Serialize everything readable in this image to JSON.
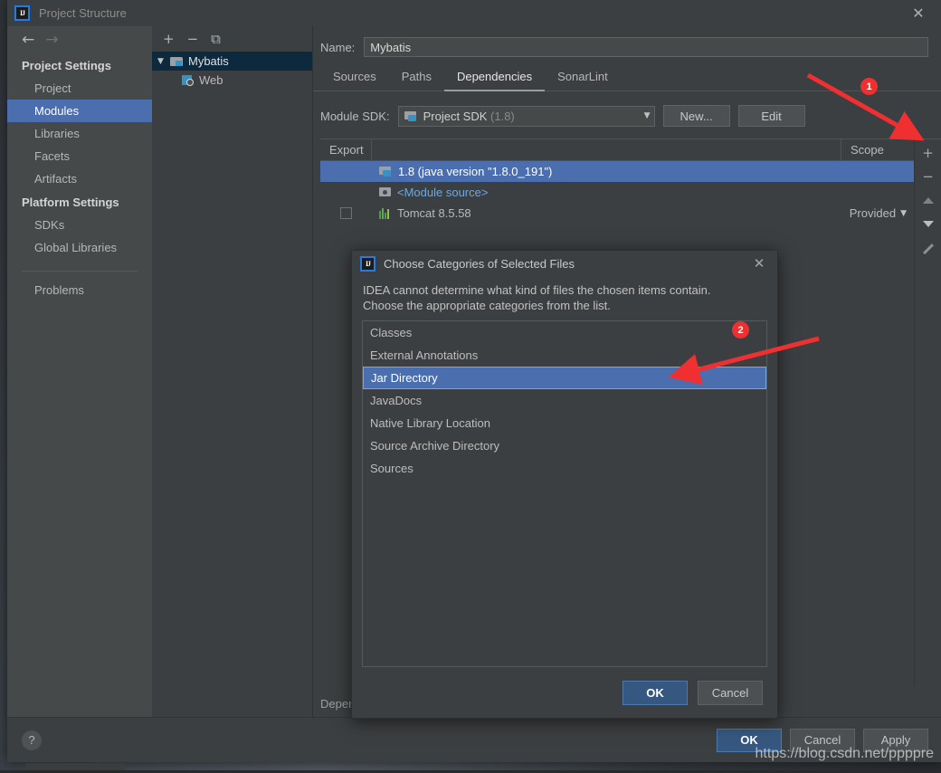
{
  "window": {
    "title": "Project Structure",
    "close_label": "✕",
    "logo_text": "IJ"
  },
  "sidebar": {
    "nav": {
      "back": "←",
      "forward": "→"
    },
    "groups": [
      {
        "title": "Project Settings",
        "items": [
          {
            "label": "Project",
            "selected": false
          },
          {
            "label": "Modules",
            "selected": true
          },
          {
            "label": "Libraries",
            "selected": false
          },
          {
            "label": "Facets",
            "selected": false
          },
          {
            "label": "Artifacts",
            "selected": false
          }
        ]
      },
      {
        "title": "Platform Settings",
        "items": [
          {
            "label": "SDKs",
            "selected": false
          },
          {
            "label": "Global Libraries",
            "selected": false
          }
        ]
      }
    ],
    "problems_label": "Problems"
  },
  "modules_pane": {
    "toolbar": {
      "add": "+",
      "remove": "−",
      "copy": "⧉"
    },
    "tree": [
      {
        "label": "Mybatis",
        "icon": "module-icon",
        "toggle": "▼",
        "level": 0,
        "selected": true
      },
      {
        "label": "Web",
        "icon": "web-facet-icon",
        "toggle": "",
        "level": 1,
        "selected": false
      }
    ]
  },
  "content": {
    "name_label": "Name:",
    "name_value": "Mybatis",
    "tabs": [
      {
        "label": "Sources",
        "active": false
      },
      {
        "label": "Paths",
        "active": false
      },
      {
        "label": "Dependencies",
        "active": true
      },
      {
        "label": "SonarLint",
        "active": false
      }
    ],
    "sdk_label": "Module SDK:",
    "sdk_value": "Project SDK",
    "sdk_version": "(1.8)",
    "sdk_caret": "▼",
    "new_button": "New...",
    "edit_button": "Edit",
    "footer_label": "Depen",
    "table": {
      "headers": {
        "export": "Export",
        "scope": "Scope"
      },
      "rows": [
        {
          "export_checkbox": false,
          "show_checkbox": false,
          "icon": "jdk-icon",
          "label": "1.8 (java version \"1.8.0_191\")",
          "scope": "",
          "scope_caret": "",
          "selected": true,
          "link": false
        },
        {
          "export_checkbox": false,
          "show_checkbox": false,
          "icon": "module-source-icon",
          "label": "<Module source>",
          "scope": "",
          "scope_caret": "",
          "selected": false,
          "link": true
        },
        {
          "export_checkbox": false,
          "show_checkbox": true,
          "icon": "library-icon",
          "label": "Tomcat 8.5.58",
          "scope": "Provided",
          "scope_caret": "▼",
          "selected": false,
          "link": false
        }
      ]
    },
    "side_toolbar": {
      "add": "+",
      "remove": "−",
      "move_up": "move-up",
      "move_down": "move-down",
      "edit": "edit"
    }
  },
  "bottom_bar": {
    "help": "?",
    "ok": "OK",
    "cancel": "Cancel",
    "apply": "Apply"
  },
  "dialog": {
    "title": "Choose Categories of Selected Files",
    "logo_text": "IJ",
    "close_label": "✕",
    "message_line1": "IDEA cannot determine what kind of files the chosen items contain.",
    "message_line2": "Choose the appropriate categories from the list.",
    "categories": [
      {
        "label": "Classes",
        "selected": false
      },
      {
        "label": "External Annotations",
        "selected": false
      },
      {
        "label": "Jar Directory",
        "selected": true
      },
      {
        "label": "JavaDocs",
        "selected": false
      },
      {
        "label": "Native Library Location",
        "selected": false
      },
      {
        "label": "Source Archive Directory",
        "selected": false
      },
      {
        "label": "Sources",
        "selected": false
      }
    ],
    "ok": "OK",
    "cancel": "Cancel"
  },
  "annotations": {
    "badge_1": "1",
    "badge_2": "2"
  },
  "watermark": "https://blog.csdn.net/ppppre",
  "colors": {
    "accent_blue": "#4b6eaf",
    "primary_button": "#365880",
    "annotation_red": "#f03030",
    "window_bg": "#3c3f41",
    "sidebar_bg": "#45494a",
    "tree_selected": "#0d293e"
  }
}
